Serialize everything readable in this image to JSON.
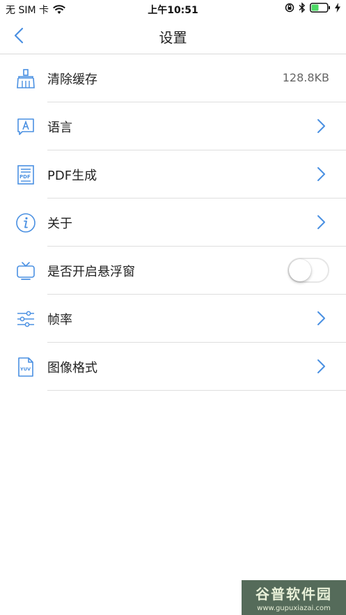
{
  "status_bar": {
    "carrier": "无 SIM 卡",
    "time": "上午10:51"
  },
  "nav": {
    "title": "设置"
  },
  "settings": [
    {
      "label": "清除缓存",
      "value": "128.8KB",
      "icon": "broom-icon"
    },
    {
      "label": "语言",
      "icon": "language-icon"
    },
    {
      "label": "PDF生成",
      "icon": "pdf-document-icon"
    },
    {
      "label": "关于",
      "icon": "info-icon"
    },
    {
      "label": "是否开启悬浮窗",
      "icon": "tv-icon",
      "toggle_on": false
    },
    {
      "label": "帧率",
      "icon": "sliders-icon"
    },
    {
      "label": "图像格式",
      "icon": "yuv-file-icon"
    }
  ],
  "watermark": {
    "logo": "谷普软件园",
    "url": "www.gupuxiazai.com"
  },
  "colors": {
    "accent": "#4a90e2",
    "divider": "#dedede"
  }
}
